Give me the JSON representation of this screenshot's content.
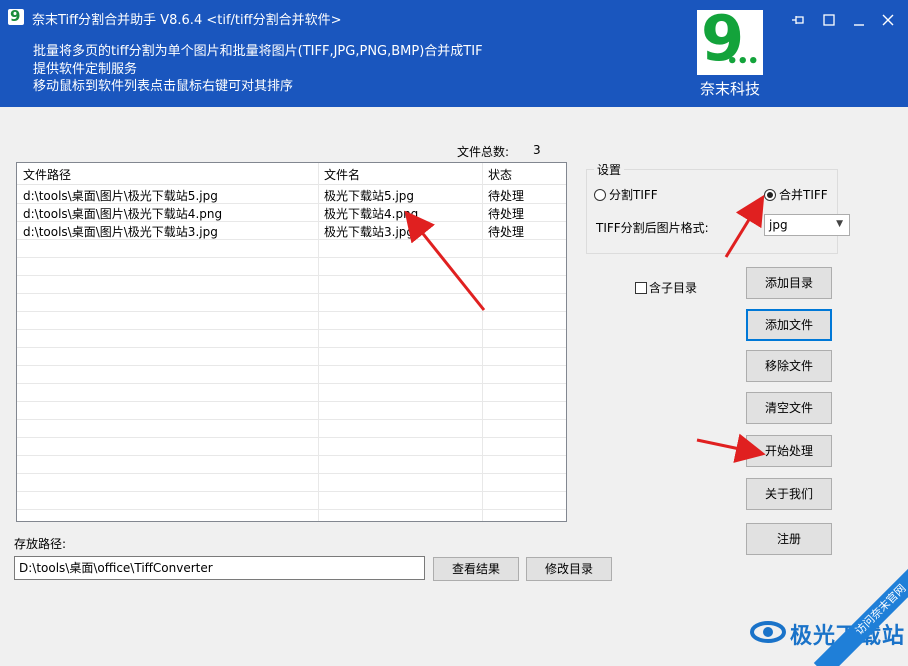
{
  "window": {
    "title": "奈末Tiff分割合并助手 V8.6.4   <tif/tiff分割合并软件>",
    "desc_lines": [
      "批量将多页的tiff分割为单个图片和批量将图片(TIFF,JPG,PNG,BMP)合并成TIF",
      "提供软件定制服务",
      "移动鼠标到软件列表点击鼠标右键可对其排序"
    ],
    "controls": [
      "pin-icon",
      "maximize-icon",
      "minimize-icon",
      "close-icon"
    ]
  },
  "brand": {
    "name": "奈末科技",
    "logo_text": "9"
  },
  "file_count": {
    "label": "文件总数:",
    "value": "3"
  },
  "list": {
    "columns": [
      "文件路径",
      "文件名",
      "状态"
    ],
    "rows": [
      {
        "path": "d:\\tools\\桌面\\图片\\极光下载站5.jpg",
        "name": "极光下载站5.jpg",
        "status": "待处理"
      },
      {
        "path": "d:\\tools\\桌面\\图片\\极光下载站4.png",
        "name": "极光下载站4.png",
        "status": "待处理"
      },
      {
        "path": "d:\\tools\\桌面\\图片\\极光下载站3.jpg",
        "name": "极光下载站3.jpg",
        "status": "待处理"
      }
    ]
  },
  "settings": {
    "title": "设置",
    "radio_split": "分割TIFF",
    "radio_merge": "合并TIFF",
    "selected": "merge",
    "format_label": "TIFF分割后图片格式:",
    "format_value": "jpg"
  },
  "subdir_checkbox": {
    "label": "含子目录",
    "checked": false
  },
  "buttons": {
    "add_dir": "添加目录",
    "add_file": "添加文件",
    "remove_file": "移除文件",
    "clear_file": "清空文件",
    "start": "开始处理",
    "about": "关于我们",
    "register": "注册",
    "view_result": "查看结果",
    "change_dir": "修改目录"
  },
  "output": {
    "label": "存放路径:",
    "path": "D:\\tools\\桌面\\office\\TiffConverter"
  },
  "watermark": {
    "text": "极光下载站",
    "ribbon": "访问奈末官网"
  },
  "colors": {
    "header": "#1a56be",
    "brand_green": "#13a33b",
    "arrow": "#e02020",
    "focus": "#0078d7"
  }
}
